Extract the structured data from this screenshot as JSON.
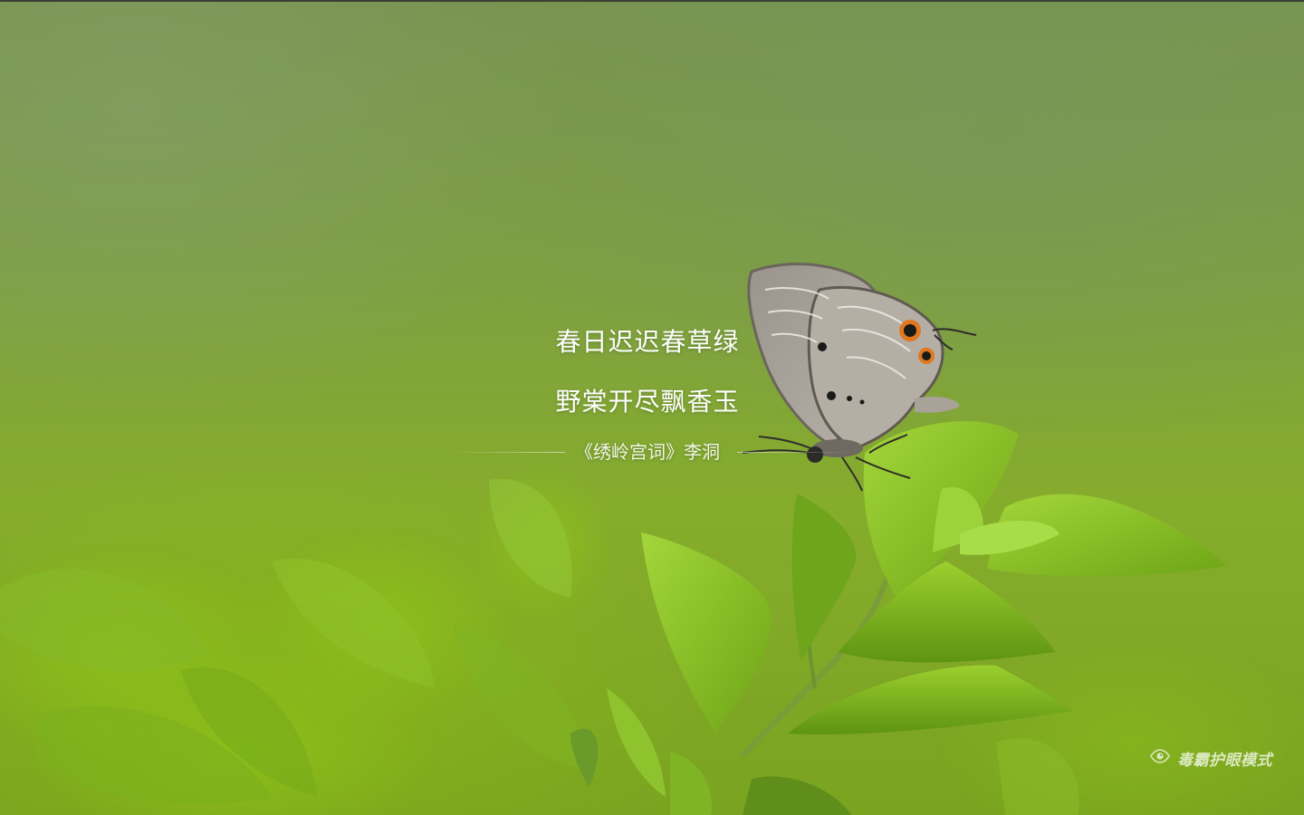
{
  "poem": {
    "line1": "春日迟迟春草绿",
    "line2": "野棠开尽飘香玉",
    "source": "《绣岭宫词》李洞"
  },
  "eye_mode": {
    "label": "毒霸护眼模式",
    "icon": "eye-icon"
  },
  "colors": {
    "background": "#7ea040",
    "leaf": "#8cc11f",
    "text": "#ffffff"
  }
}
